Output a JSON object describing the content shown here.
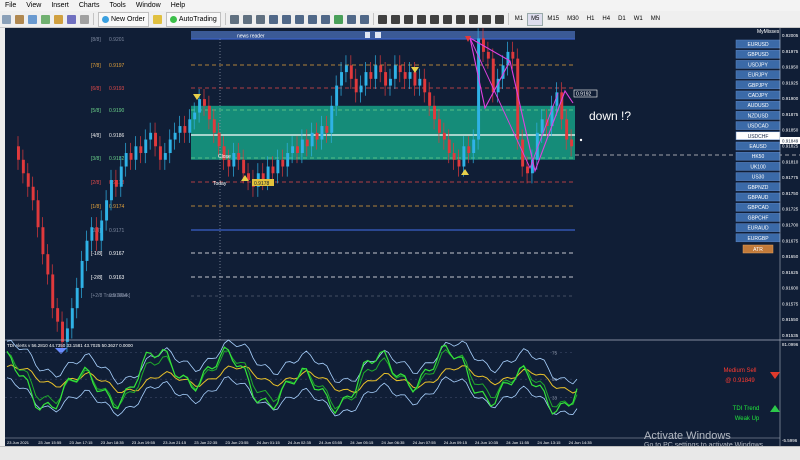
{
  "menu": [
    "File",
    "View",
    "Insert",
    "Charts",
    "Tools",
    "Window",
    "Help"
  ],
  "toolbar": {
    "new_order": "New Order",
    "autotrading": "AutoTrading",
    "timeframes": [
      "M1",
      "M5",
      "M15",
      "M30",
      "H1",
      "H4",
      "D1",
      "W1",
      "MN"
    ],
    "active_timeframe": "M5"
  },
  "news_reader": {
    "label": "news reader"
  },
  "fib_levels": [
    {
      "label": "[8/8]",
      "price": "0.9201",
      "color": "#7f8aa0"
    },
    {
      "label": "[7/8]",
      "price": "0.9197",
      "color": "#e3a23b"
    },
    {
      "label": "[6/8]",
      "price": "0.9193",
      "color": "#e34a4a"
    },
    {
      "label": "[5/8]",
      "price": "0.9190",
      "color": "#6bd28a"
    },
    {
      "label": "[4/8]",
      "price": "0.9186",
      "color": "#e9e9e9"
    },
    {
      "label": "[3/8]",
      "price": "0.9182",
      "color": "#6bd28a"
    },
    {
      "label": "[2/8]",
      "price": "0.9178",
      "color": "#e34a4a"
    },
    {
      "label": "[1/8]",
      "price": "0.9174",
      "color": "#e3a23b"
    },
    {
      "label": "[0/8]",
      "price": "0.9171",
      "color": "#7f8aa0"
    },
    {
      "label": "[-1/8]",
      "price": "0.9167",
      "color": "#ffffff"
    },
    {
      "label": "[-2/8]",
      "price": "0.9163",
      "color": "#ffffff"
    },
    {
      "label": "[+2/8 Trade Mark]",
      "price": "0.91604",
      "color": "#7f8aa0"
    }
  ],
  "annotations": {
    "close": "Close",
    "today": "Today",
    "today_price": "0.9178",
    "down": "down !?",
    "tag_price": "0.9192"
  },
  "symbols": {
    "title": "MyMisses",
    "items": [
      "EURUSD",
      "GBPUSD",
      "USDJPY",
      "EURJPY",
      "GBPJPY",
      "CADJPY",
      "AUDUSD",
      "NZDUSD",
      "USDCAD",
      "USDCHF",
      "EAUSD",
      "HK50",
      "UK100",
      "US30",
      "GBPNZD",
      "GBPAUD",
      "GBPCAD",
      "GBPCHF",
      "EURAUD",
      "EURGBP"
    ],
    "active": "USDCHF",
    "atr_label": "ATR"
  },
  "price_axis": [
    "0.92005",
    "0.91975",
    "0.91950",
    "0.91925",
    "0.91900",
    "0.91875",
    "0.91850",
    "0.91825",
    "0.91810",
    "0.91775",
    "0.91750",
    "0.91725",
    "0.91700",
    "0.91675",
    "0.91650",
    "0.91625",
    "0.91600",
    "0.91575",
    "0.91550",
    "0.91535"
  ],
  "price_current": "0.91849",
  "tdi": {
    "header": "TDI Alerts v 56.2810 44.7350 33.1581 43.7025 50.3627 0.0000",
    "levels": [
      "75",
      "50",
      "33"
    ],
    "axis_top": "81.0996",
    "axis_bot": "-5.5996",
    "medium_sell": "Medium Sell",
    "medium_price": "@ 0.91849",
    "trend": "TDI Trend",
    "weak": "Weak Up"
  },
  "time_axis": [
    "23 Jun 2021",
    "23 Jun 15:55",
    "23 Jun 17:15",
    "23 Jun 18:35",
    "23 Jun 19:55",
    "23 Jun 21:15",
    "23 Jun 22:35",
    "23 Jun 23:55",
    "24 Jun 01:15",
    "24 Jun 02:35",
    "24 Jun 03:55",
    "24 Jun 05:15",
    "24 Jun 06:35",
    "24 Jun 07:55",
    "24 Jun 09:15",
    "24 Jun 10:35",
    "24 Jun 11:55",
    "24 Jun 13:15",
    "24 Jun 14:35"
  ],
  "watermark": {
    "line1": "Activate Windows",
    "line2": "Go to PC settings to activate Windows."
  },
  "colors": {
    "bg": "#101e36",
    "bull": "#2fb2e6",
    "bear": "#e0393c",
    "box": "#16a085",
    "zigzag": "#e040e0",
    "tdi_green": "#34e33b",
    "tdi_yellow": "#e8c12a",
    "tdi_band": "#a9d2ff"
  }
}
